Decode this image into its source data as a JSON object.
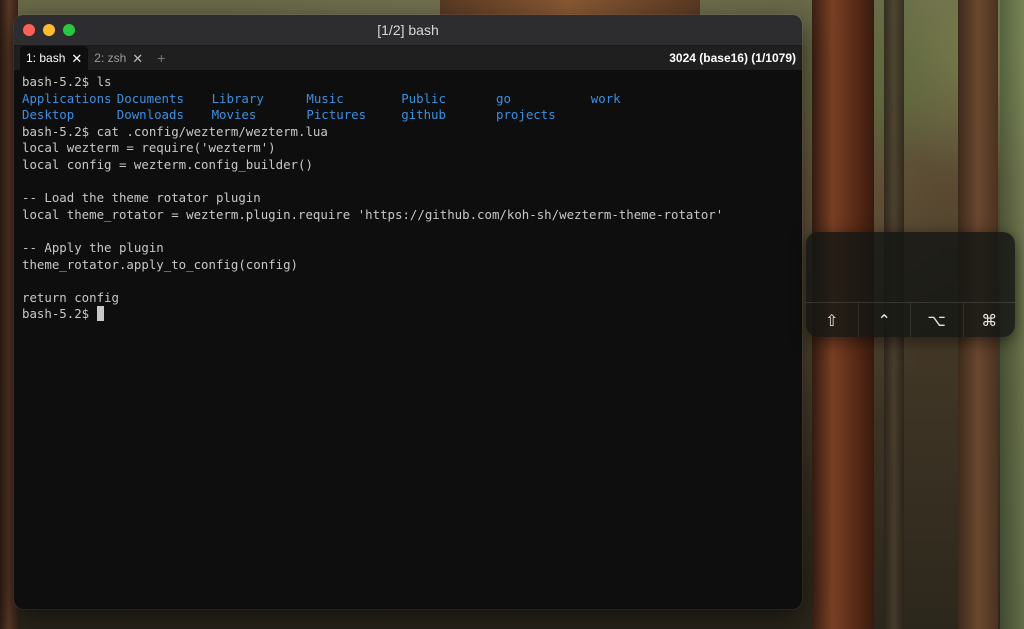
{
  "window": {
    "title": "[1/2] bash"
  },
  "tabs": [
    {
      "label": "1: bash",
      "active": true
    },
    {
      "label": "2: zsh",
      "active": false
    }
  ],
  "tab_close_glyph": "✕",
  "new_tab_glyph": "+",
  "status_right": "3024 (base16) (1/1079)",
  "terminal": {
    "lines": [
      "bash-5.2$ ls",
      "__LS__",
      "bash-5.2$ cat .config/wezterm/wezterm.lua",
      "local wezterm = require('wezterm')",
      "local config = wezterm.config_builder()",
      "",
      "-- Load the theme rotator plugin",
      "local theme_rotator = wezterm.plugin.require 'https://github.com/koh-sh/wezterm-theme-rotator'",
      "",
      "-- Apply the plugin",
      "theme_rotator.apply_to_config(config)",
      "",
      "return config"
    ],
    "ls_rows": [
      [
        "Applications",
        "Documents",
        "Library",
        "Music",
        "Public",
        "go",
        "work"
      ],
      [
        "Desktop",
        "Downloads",
        "Movies",
        "Pictures",
        "github",
        "projects",
        ""
      ]
    ],
    "prompt": "bash-5.2$ "
  },
  "key_panel": {
    "keys": [
      {
        "name": "shift",
        "glyph": "⇧"
      },
      {
        "name": "control",
        "glyph": "⌃"
      },
      {
        "name": "option",
        "glyph": "⌥"
      },
      {
        "name": "command",
        "glyph": "⌘"
      }
    ]
  },
  "colors": {
    "ls_directory": "#3d8fe0",
    "terminal_fg": "#c8c8c8",
    "terminal_bg": "#0e0e0f"
  }
}
